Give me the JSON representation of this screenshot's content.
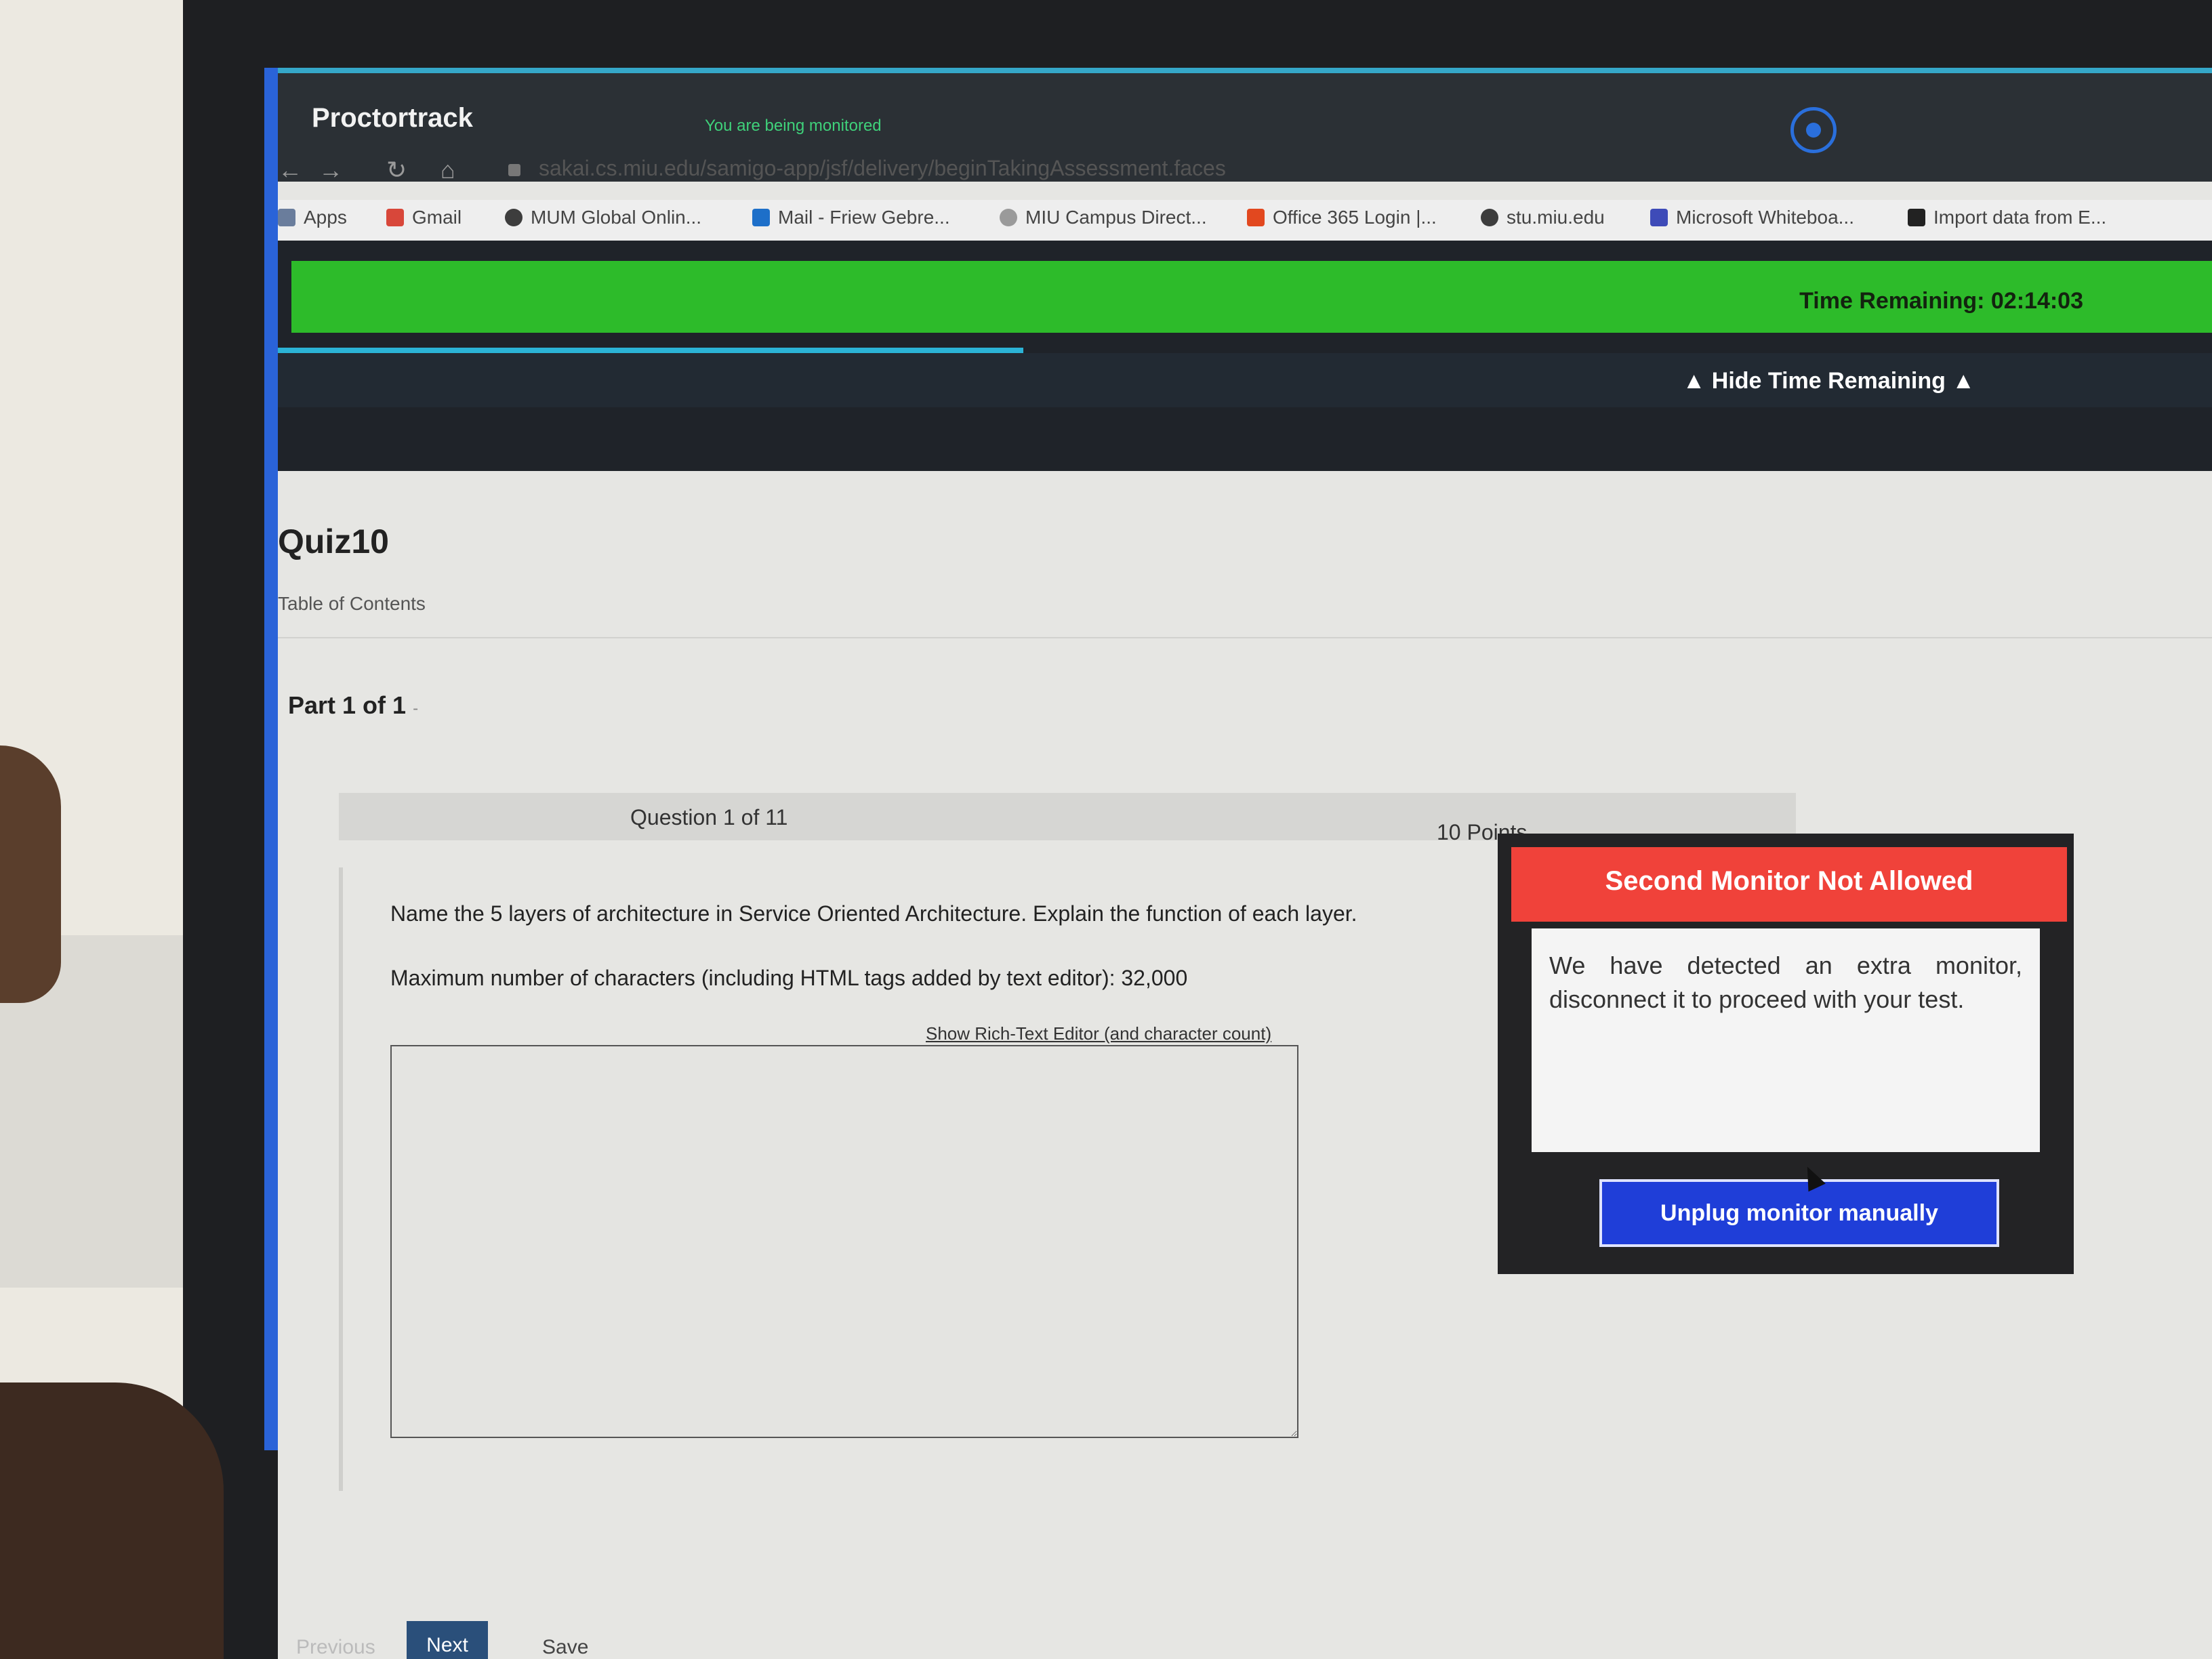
{
  "proctortrack": {
    "title": "Proctortrack",
    "monitor_notice": "You are being monitored"
  },
  "browser": {
    "url": "sakai.cs.miu.edu/samigo-app/jsf/delivery/beginTakingAssessment.faces",
    "bookmarks": [
      {
        "label": "Apps",
        "icon": "apps-grid-icon"
      },
      {
        "label": "Gmail",
        "icon": "gmail-icon"
      },
      {
        "label": "MUM Global Onlin...",
        "icon": "globe-icon"
      },
      {
        "label": "Mail - Friew Gebre...",
        "icon": "outlook-icon"
      },
      {
        "label": "MIU Campus Direct...",
        "icon": "campus-icon"
      },
      {
        "label": "Office 365 Login |...",
        "icon": "office-icon"
      },
      {
        "label": "stu.miu.edu",
        "icon": "globe-icon"
      },
      {
        "label": "Microsoft Whiteboa...",
        "icon": "whiteboard-icon"
      },
      {
        "label": "Import data from E...",
        "icon": "import-icon"
      }
    ]
  },
  "timer": {
    "time_remaining": "Time Remaining: 02:14:03",
    "hide_label": "▲ Hide Time Remaining ▲"
  },
  "quiz": {
    "title": "Quiz10",
    "toc_label": "Table of Contents",
    "part_label": "Part 1 of 1",
    "part_suffix": "-",
    "question_number": "Question 1 of 11",
    "points": "10 Points",
    "question_text": "Name the 5 layers of architecture in Service Oriented Architecture. Explain the function of each layer.",
    "max_chars_text": "Maximum number of characters (including HTML tags added by text editor): 32,000",
    "rich_text_link": "Show Rich-Text Editor (and character count)",
    "answer_value": "",
    "buttons": {
      "previous": "Previous",
      "next": "Next",
      "save": "Save"
    }
  },
  "modal": {
    "title": "Second Monitor Not Allowed",
    "message": "We have detected an extra monitor, disconnect it to proceed with your test.",
    "button_label": "Unplug monitor manually"
  },
  "colors": {
    "proctortrack_bar": "#2b3035",
    "timer_green": "#2dbb2a",
    "modal_header_red": "#f0423a",
    "modal_button_blue": "#1f3ed8",
    "next_button": "#2a4f7a"
  }
}
